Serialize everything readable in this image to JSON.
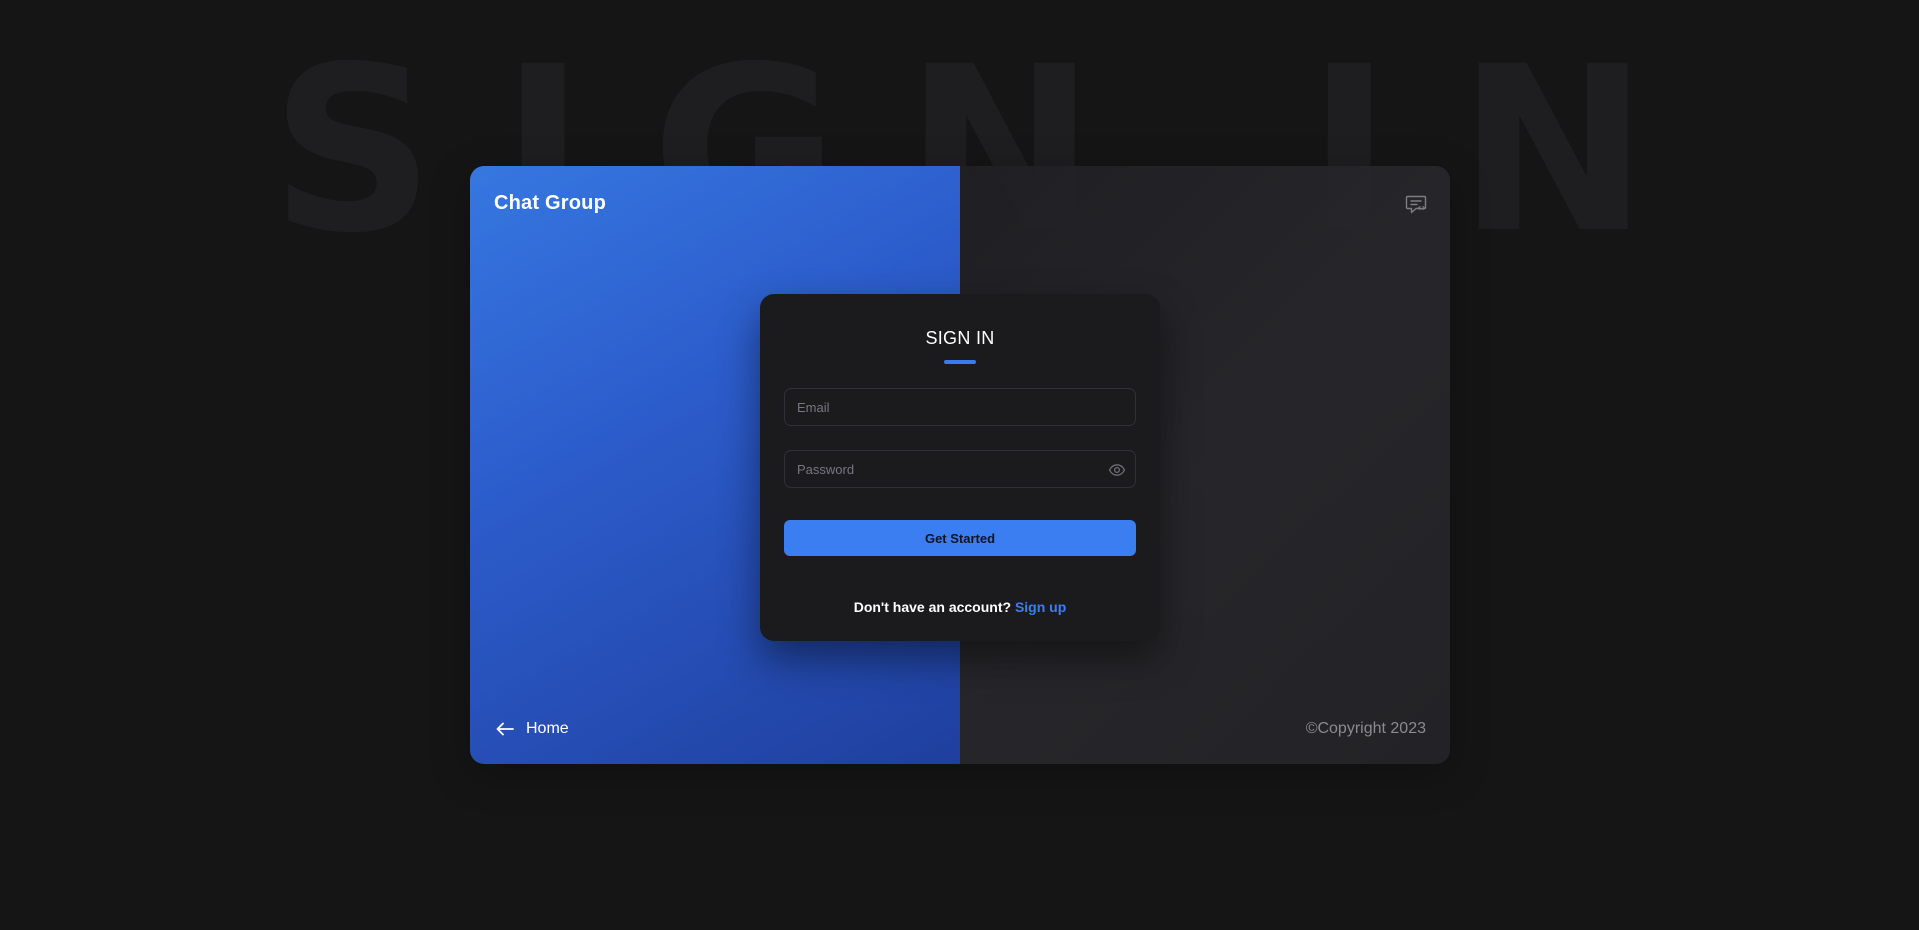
{
  "background": {
    "watermark_text": "SIGN IN"
  },
  "brand": {
    "title": "Chat Group"
  },
  "header": {
    "chat_icon": "chat-bubble-icon"
  },
  "form": {
    "title": "SIGN IN",
    "email_placeholder": "Email",
    "email_value": "",
    "password_placeholder": "Password",
    "password_value": "",
    "password_toggle_icon": "eye-icon",
    "submit_label": "Get Started",
    "signup_prompt": "Don't have an account?",
    "signup_link": "Sign up"
  },
  "footer": {
    "home_label": "Home",
    "home_icon": "arrow-left-icon",
    "copyright": "©Copyright 2023"
  },
  "colors": {
    "page_background": "#151515",
    "accent": "#3a7ef2",
    "left_panel_gradient_start": "#3677e0",
    "left_panel_gradient_end": "#1f3f9e",
    "card_background": "#1b1b1e"
  }
}
